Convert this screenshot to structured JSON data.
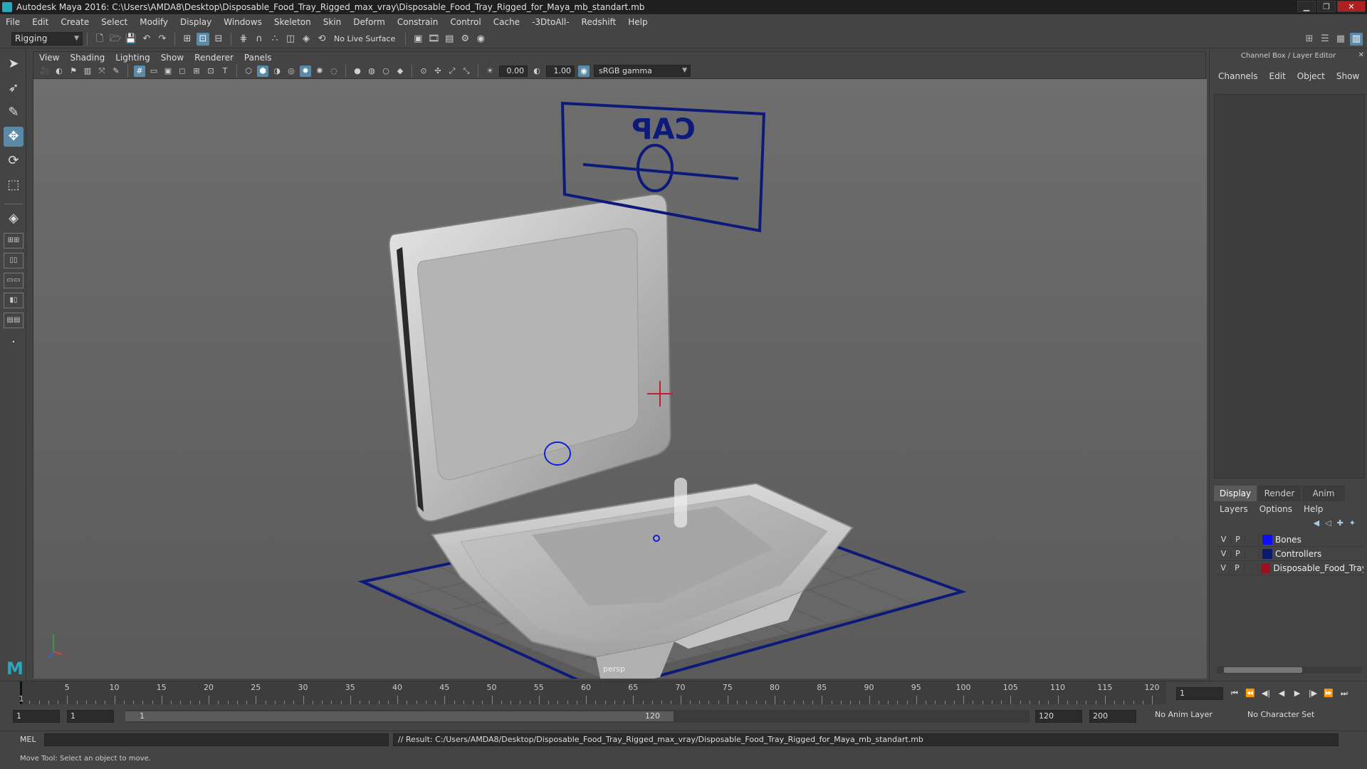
{
  "window": {
    "title": "Autodesk Maya 2016: C:\\Users\\AMDA8\\Desktop\\Disposable_Food_Tray_Rigged_max_vray\\Disposable_Food_Tray_Rigged_for_Maya_mb_standart.mb",
    "min": "▁",
    "max": "❐",
    "close": "✕"
  },
  "menubar": [
    "File",
    "Edit",
    "Create",
    "Select",
    "Modify",
    "Display",
    "Windows",
    "Skeleton",
    "Skin",
    "Deform",
    "Constrain",
    "Control",
    "Cache",
    "-3DtoAll-",
    "Redshift",
    "Help"
  ],
  "shelf": {
    "mode": "Rigging",
    "live_surface": "No Live Surface"
  },
  "viewport": {
    "menu": [
      "View",
      "Shading",
      "Lighting",
      "Show",
      "Renderer",
      "Panels"
    ],
    "exposure": "0.00",
    "gamma": "1.00",
    "color_space": "sRGB gamma",
    "camera": "persp",
    "controller_label": "CAP"
  },
  "channel_box": {
    "title": "Channel Box / Layer Editor",
    "tabs": [
      "Channels",
      "Edit",
      "Object",
      "Show"
    ]
  },
  "layer_editor": {
    "tabs": [
      "Display",
      "Render",
      "Anim"
    ],
    "menu": [
      "Layers",
      "Options",
      "Help"
    ],
    "layers": [
      {
        "v": "V",
        "p": "P",
        "color": "#1010ee",
        "name": "Bones"
      },
      {
        "v": "V",
        "p": "P",
        "color": "#0a1a70",
        "name": "Controllers"
      },
      {
        "v": "V",
        "p": "P",
        "color": "#9a1020",
        "name": "Disposable_Food_Tray"
      }
    ]
  },
  "timeline": {
    "ticks": [
      "5",
      "10",
      "15",
      "20",
      "25",
      "30",
      "35",
      "40",
      "45",
      "50",
      "55",
      "60",
      "65",
      "70",
      "75",
      "80",
      "85",
      "90",
      "95",
      "100",
      "105",
      "110",
      "115",
      "120"
    ],
    "current_frame": "1",
    "start_label": "1"
  },
  "range": {
    "start": "1",
    "inner_start": "1",
    "slider_start": "1",
    "slider_end": "120",
    "end": "120",
    "max": "200",
    "anim_layer": "No Anim Layer",
    "character_set": "No Character Set"
  },
  "command": {
    "lang": "MEL",
    "result": "// Result: C:/Users/AMDA8/Desktop/Disposable_Food_Tray_Rigged_max_vray/Disposable_Food_Tray_Rigged_for_Maya_mb_standart.mb"
  },
  "help_line": "Move Tool: Select an object to move."
}
